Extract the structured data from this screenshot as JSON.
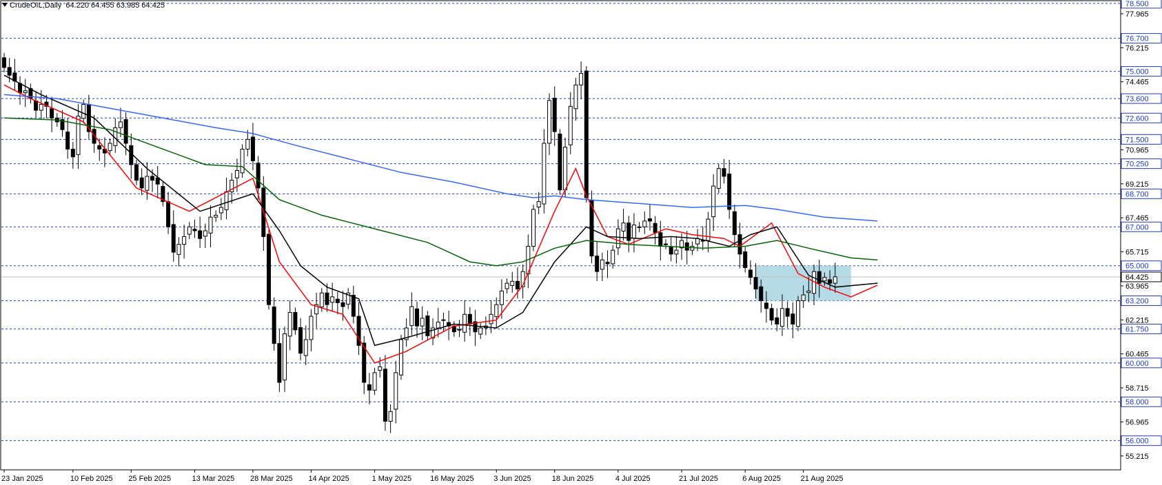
{
  "header": {
    "symbol_timeframe": "CrudeOIL,Daily",
    "ohlc": "64.220 64.455 63.985 64.425"
  },
  "chart_data": {
    "type": "candlestick",
    "instrument": "CrudeOIL",
    "timeframe": "Daily",
    "ylim": [
      54.5,
      78.6
    ],
    "y_ticks": [
      "77.965",
      "76.215",
      "74.465",
      "72.715",
      "70.965",
      "69.215",
      "67.465",
      "65.715",
      "63.965",
      "62.215",
      "60.465",
      "58.715",
      "56.965",
      "55.215"
    ],
    "levels": [
      {
        "label": "78.500",
        "value": 78.5
      },
      {
        "label": "76.700",
        "value": 76.7
      },
      {
        "label": "75.000",
        "value": 75.0
      },
      {
        "label": "73.600",
        "value": 73.6
      },
      {
        "label": "72.600",
        "value": 72.6
      },
      {
        "label": "71.500",
        "value": 71.5
      },
      {
        "label": "70.250",
        "value": 70.25
      },
      {
        "label": "68.700",
        "value": 68.7
      },
      {
        "label": "67.000",
        "value": 67.0
      },
      {
        "label": "65.000",
        "value": 65.0
      },
      {
        "label": "63.200",
        "value": 63.2
      },
      {
        "label": "61.750",
        "value": 61.75
      },
      {
        "label": "60.000",
        "value": 60.0
      },
      {
        "label": "58.000",
        "value": 58.0
      },
      {
        "label": "56.000",
        "value": 56.0
      }
    ],
    "last_price": {
      "label": "64.425",
      "value": 64.425
    },
    "x_labels": [
      {
        "label": "23 Jan 2025",
        "bar": 0
      },
      {
        "label": "10 Feb 2025",
        "bar": 13
      },
      {
        "label": "25 Feb 2025",
        "bar": 24
      },
      {
        "label": "13 Mar 2025",
        "bar": 36
      },
      {
        "label": "28 Mar 2025",
        "bar": 47
      },
      {
        "label": "14 Apr 2025",
        "bar": 58
      },
      {
        "label": "1 May 2025",
        "bar": 70
      },
      {
        "label": "16 May 2025",
        "bar": 81
      },
      {
        "label": "3 Jun 2025",
        "bar": 93
      },
      {
        "label": "18 Jun 2025",
        "bar": 104
      },
      {
        "label": "4 Jul 2025",
        "bar": 116
      },
      {
        "label": "21 Jul 2025",
        "bar": 128
      },
      {
        "label": "6 Aug 2025",
        "bar": 140
      },
      {
        "label": "21 Aug 2025",
        "bar": 151
      }
    ],
    "highlight_zone": {
      "from_bar": 142,
      "to_bar": 160,
      "low": 63.2,
      "high": 65.0,
      "color": "#a8d5e3"
    },
    "colors": {
      "ma_fast": "#ff0000",
      "ma_mid": "#000000",
      "ma_slow": "#006400",
      "ma_long": "#3366ff",
      "level": "#1f3cc7"
    },
    "closes": [
      75.2,
      74.8,
      74.5,
      73.9,
      74.0,
      73.6,
      73.0,
      73.3,
      73.2,
      72.6,
      72.4,
      72.0,
      71.0,
      70.6,
      72.7,
      73.3,
      71.9,
      71.3,
      71.0,
      70.8,
      71.3,
      72.1,
      72.4,
      71.3,
      70.2,
      69.4,
      69.0,
      69.6,
      69.4,
      69.2,
      68.3,
      67.0,
      65.7,
      66.1,
      66.5,
      67.0,
      66.8,
      66.4,
      66.8,
      67.5,
      67.6,
      68.0,
      68.8,
      69.4,
      69.9,
      71.0,
      71.5,
      70.4,
      69.0,
      66.5,
      63.0,
      61.0,
      59.0,
      61.5,
      62.6,
      61.7,
      60.5,
      61.2,
      62.4,
      63.0,
      63.6,
      63.0,
      63.4,
      63.1,
      62.9,
      63.6,
      62.4,
      60.9,
      59.0,
      58.6,
      59.5,
      59.8,
      57.0,
      57.5,
      59.5,
      61.2,
      61.8,
      62.9,
      61.9,
      62.3,
      61.4,
      61.8,
      62.1,
      62.2,
      61.9,
      61.6,
      61.7,
      62.5,
      62.0,
      61.6,
      61.8,
      61.9,
      62.5,
      63.0,
      63.7,
      64.1,
      64.2,
      63.8,
      64.7,
      66.0,
      67.9,
      68.3,
      71.3,
      73.5,
      71.9,
      68.9,
      71.1,
      73.2,
      74.3,
      74.9,
      68.5,
      65.5,
      64.7,
      65.3,
      65.1,
      65.8,
      66.9,
      67.2,
      66.3,
      67.1,
      67.0,
      67.3,
      67.3,
      66.7,
      66.0,
      66.1,
      65.6,
      65.8,
      66.3,
      65.8,
      66.0,
      66.4,
      66.3,
      67.4,
      69.1,
      70.0,
      69.6,
      67.9,
      66.6,
      65.6,
      64.9,
      64.4,
      63.8,
      63.2,
      62.8,
      62.2,
      62.0,
      62.8,
      62.4,
      62.0,
      63.2,
      63.5,
      63.7,
      64.7,
      64.1,
      64.4,
      64.1,
      64.43
    ],
    "series": [
      {
        "name": "MA fast",
        "color": "#ff0000",
        "points": [
          [
            0,
            74.3
          ],
          [
            5,
            73.6
          ],
          [
            15,
            72.4
          ],
          [
            25,
            69.0
          ],
          [
            35,
            67.8
          ],
          [
            47,
            69.5
          ],
          [
            52,
            65.2
          ],
          [
            58,
            63.0
          ],
          [
            64,
            62.5
          ],
          [
            70,
            60.0
          ],
          [
            76,
            60.6
          ],
          [
            85,
            61.9
          ],
          [
            93,
            62.2
          ],
          [
            98,
            64.0
          ],
          [
            104,
            67.8
          ],
          [
            108,
            70.0
          ],
          [
            110,
            68.6
          ],
          [
            114,
            66.5
          ],
          [
            118,
            66.1
          ],
          [
            125,
            66.9
          ],
          [
            130,
            66.6
          ],
          [
            136,
            66.4
          ],
          [
            139,
            66.0
          ],
          [
            145,
            67.2
          ],
          [
            150,
            64.6
          ],
          [
            155,
            63.9
          ],
          [
            160,
            63.4
          ],
          [
            165,
            64.0
          ]
        ]
      },
      {
        "name": "MA mid",
        "color": "#000000",
        "points": [
          [
            0,
            74.8
          ],
          [
            7,
            73.8
          ],
          [
            17,
            72.6
          ],
          [
            27,
            70.0
          ],
          [
            37,
            67.8
          ],
          [
            47,
            68.7
          ],
          [
            52,
            66.8
          ],
          [
            56,
            65.0
          ],
          [
            61,
            63.9
          ],
          [
            67,
            63.3
          ],
          [
            70,
            60.9
          ],
          [
            76,
            61.3
          ],
          [
            85,
            62.0
          ],
          [
            93,
            61.8
          ],
          [
            98,
            62.6
          ],
          [
            104,
            65.2
          ],
          [
            110,
            67.0
          ],
          [
            114,
            66.5
          ],
          [
            120,
            66.4
          ],
          [
            126,
            66.5
          ],
          [
            131,
            66.4
          ],
          [
            137,
            66.0
          ],
          [
            141,
            66.6
          ],
          [
            146,
            67.0
          ],
          [
            152,
            64.5
          ],
          [
            157,
            63.9
          ],
          [
            165,
            64.1
          ]
        ]
      },
      {
        "name": "MA slow",
        "color": "#006400",
        "points": [
          [
            0,
            72.6
          ],
          [
            10,
            72.5
          ],
          [
            20,
            72.0
          ],
          [
            30,
            71.0
          ],
          [
            38,
            70.2
          ],
          [
            45,
            70.1
          ],
          [
            52,
            68.4
          ],
          [
            60,
            67.6
          ],
          [
            70,
            66.9
          ],
          [
            80,
            66.2
          ],
          [
            88,
            65.2
          ],
          [
            93,
            65.0
          ],
          [
            98,
            65.2
          ],
          [
            104,
            65.9
          ],
          [
            110,
            66.3
          ],
          [
            118,
            66.1
          ],
          [
            125,
            66.0
          ],
          [
            132,
            65.9
          ],
          [
            140,
            66.0
          ],
          [
            146,
            66.3
          ],
          [
            152,
            65.9
          ],
          [
            160,
            65.4
          ],
          [
            165,
            65.3
          ]
        ]
      },
      {
        "name": "MA long",
        "color": "#3366ff",
        "points": [
          [
            0,
            73.8
          ],
          [
            10,
            73.6
          ],
          [
            20,
            73.1
          ],
          [
            30,
            72.6
          ],
          [
            40,
            72.1
          ],
          [
            47,
            71.8
          ],
          [
            55,
            71.2
          ],
          [
            65,
            70.5
          ],
          [
            75,
            69.8
          ],
          [
            85,
            69.3
          ],
          [
            95,
            68.7
          ],
          [
            100,
            68.5
          ],
          [
            104,
            68.6
          ],
          [
            110,
            68.4
          ],
          [
            120,
            68.2
          ],
          [
            130,
            68.0
          ],
          [
            140,
            68.1
          ],
          [
            146,
            67.9
          ],
          [
            155,
            67.5
          ],
          [
            165,
            67.3
          ]
        ]
      }
    ]
  }
}
